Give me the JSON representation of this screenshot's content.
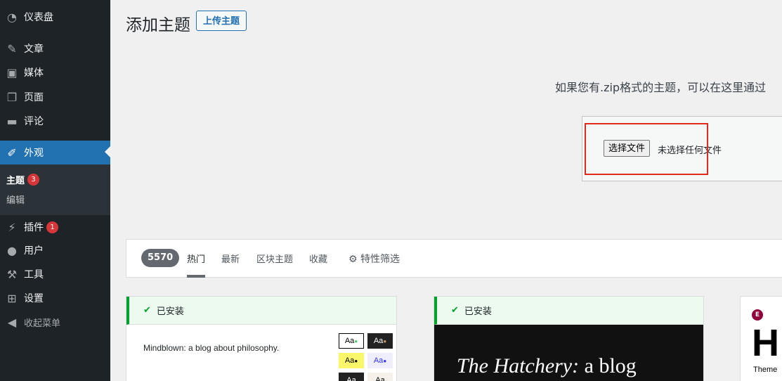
{
  "sidebar": {
    "items": [
      {
        "label": "仪表盘",
        "icon": "dashboard-icon"
      },
      {
        "label": "文章",
        "icon": "pin-icon"
      },
      {
        "label": "媒体",
        "icon": "media-icon"
      },
      {
        "label": "页面",
        "icon": "pages-icon"
      },
      {
        "label": "评论",
        "icon": "comment-icon"
      },
      {
        "label": "外观",
        "icon": "appearance-icon"
      },
      {
        "label": "插件",
        "icon": "plugin-icon",
        "badge": "1"
      },
      {
        "label": "用户",
        "icon": "user-icon"
      },
      {
        "label": "工具",
        "icon": "wrench-icon"
      },
      {
        "label": "设置",
        "icon": "settings-icon"
      },
      {
        "label": "收起菜单",
        "icon": "collapse-icon"
      }
    ],
    "submenu": [
      {
        "label": "主题",
        "badge": "3"
      },
      {
        "label": "编辑"
      }
    ]
  },
  "header": {
    "title": "添加主题",
    "upload_label": "上传主题"
  },
  "upload": {
    "description": "如果您有.zip格式的主题，可以在这里通过",
    "choose_file": "选择文件",
    "no_file": "未选择任何文件"
  },
  "filters": {
    "count": "5570",
    "tabs": [
      "热门",
      "最新",
      "区块主题",
      "收藏"
    ],
    "feature_filter": "特性筛选"
  },
  "cards": {
    "installed_label": "已安装",
    "card1_text": "Mindblown: a blog about philosophy.",
    "swatch_label": "Aa",
    "card2_title_italic": "The Hatchery:",
    "card2_title_rest": " a blog",
    "card3_letter": "H",
    "card3_word": "Theme"
  },
  "colors": {
    "sidebar_bg": "#1d2327",
    "accent": "#2271b1",
    "installed_green": "#00a32a",
    "badge_red": "#d63638"
  }
}
